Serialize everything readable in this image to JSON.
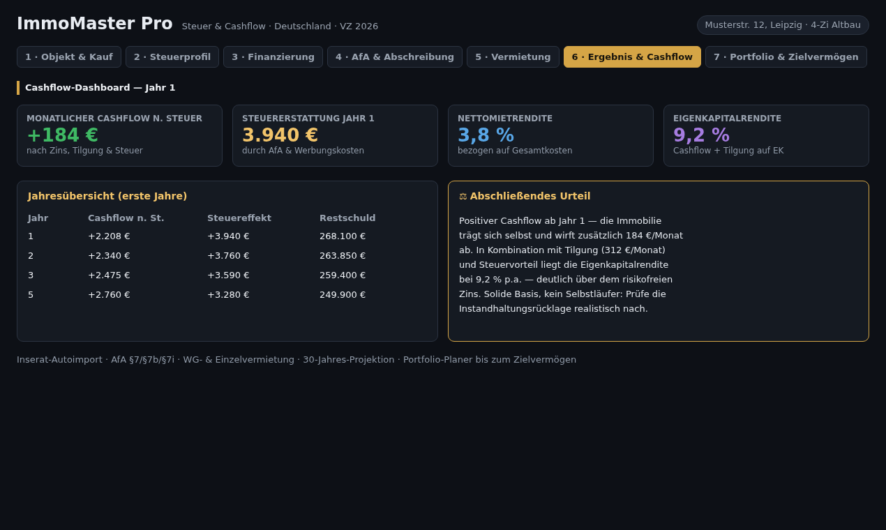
{
  "header": {
    "title": "ImmoMaster Pro",
    "subtitle": "Steuer & Cashflow · Deutschland · VZ 2026",
    "property": "Musterstr. 12, Leipzig · 4-Zi Altbau"
  },
  "tabs": [
    {
      "label": "1 · Objekt & Kauf",
      "selected": false
    },
    {
      "label": "2 · Steuerprofil",
      "selected": false
    },
    {
      "label": "3 · Finanzierung",
      "selected": false
    },
    {
      "label": "4 · AfA & Abschreibung",
      "selected": false
    },
    {
      "label": "5 · Vermietung",
      "selected": false
    },
    {
      "label": "6 · Ergebnis & Cashflow",
      "selected": true
    },
    {
      "label": "7 · Portfolio & Zielvermögen",
      "selected": false
    }
  ],
  "section_title": "Cashflow-Dashboard — Jahr 1",
  "kpis": [
    {
      "label": "MONATLICHER CASHFLOW N. STEUER",
      "value": "+184 €",
      "caption": "nach Zins, Tilgung & Steuer",
      "color": "#3fb964"
    },
    {
      "label": "STEUERERSTATTUNG JAHR 1",
      "value": "3.940 €",
      "caption": "durch AfA & Werbungskosten",
      "color": "#f2c46a"
    },
    {
      "label": "NETTOMIETRENDITE",
      "value": "3,8 %",
      "caption": "bezogen auf Gesamtkosten",
      "color": "#58a6e6"
    },
    {
      "label": "EIGENKAPITALRENDITE",
      "value": "9,2 %",
      "caption": "Cashflow + Tilgung auf EK",
      "color": "#a67ce0"
    }
  ],
  "overview": {
    "title": "Jahresübersicht (erste Jahre)",
    "columns": [
      "Jahr",
      "Cashflow n. St.",
      "Steuereffekt",
      "Restschuld"
    ],
    "rows": [
      [
        "1",
        "+2.208 €",
        "+3.940 €",
        "268.100 €"
      ],
      [
        "2",
        "+2.340 €",
        "+3.760 €",
        "263.850 €"
      ],
      [
        "3",
        "+2.475 €",
        "+3.590 €",
        "259.400 €"
      ],
      [
        "5",
        "+2.760 €",
        "+3.280 €",
        "249.900 €"
      ]
    ]
  },
  "verdict": {
    "icon": "⚖",
    "title": "Abschließendes Urteil",
    "text": "Positiver Cashflow ab Jahr 1 — die Immobilie trägt sich selbst und wirft zusätzlich 184 €/Monat ab. In Kombination mit Tilgung (312 €/Monat) und Steuervorteil liegt die Eigenkapitalrendite bei 9,2 % p.a. — deutlich über dem risikofreien Zins. Solide Basis, kein Selbstläufer: Prüfe die Instandhaltungsrücklage realistisch nach."
  },
  "footer": "Inserat-Autoimport · AfA §7/§7b/§7i · WG- & Einzelvermietung · 30-Jahres-Projektion · Portfolio-Planer bis zum Zielvermögen"
}
